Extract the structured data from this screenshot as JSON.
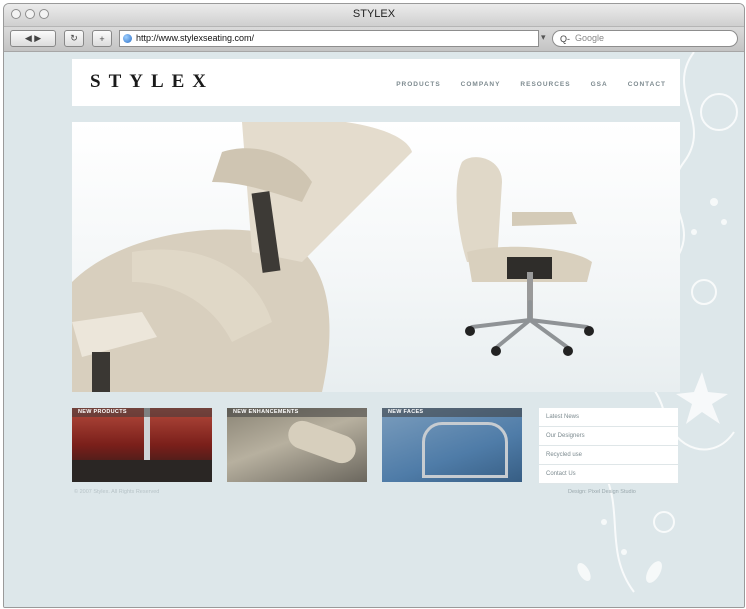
{
  "window": {
    "title": "STYLEX"
  },
  "toolbar": {
    "back_label": "◀ ▶",
    "reload_label": "↻",
    "add_label": "+",
    "url": "http://www.stylexseating.com/",
    "search_placeholder": "Google",
    "search_prefix": "Q-"
  },
  "site": {
    "logo": "STYLEX",
    "nav": [
      "PRODUCTS",
      "COMPANY",
      "RESOURCES",
      "GSA",
      "CONTACT"
    ]
  },
  "tiles": [
    {
      "label": "NEW PRODUCTS"
    },
    {
      "label": "NEW ENHANCEMENTS"
    },
    {
      "label": "NEW FACES"
    }
  ],
  "sidelinks": [
    "Latest News",
    "Our Designers",
    "Recycled use",
    "Contact Us"
  ],
  "footer": {
    "copyright": "© 2007 Stylex. All Rights Reserved",
    "credit": "Design: Pixel Design Studio"
  },
  "colors": {
    "page_bg": "#dde7ea",
    "chair": "#ddd5c4"
  }
}
